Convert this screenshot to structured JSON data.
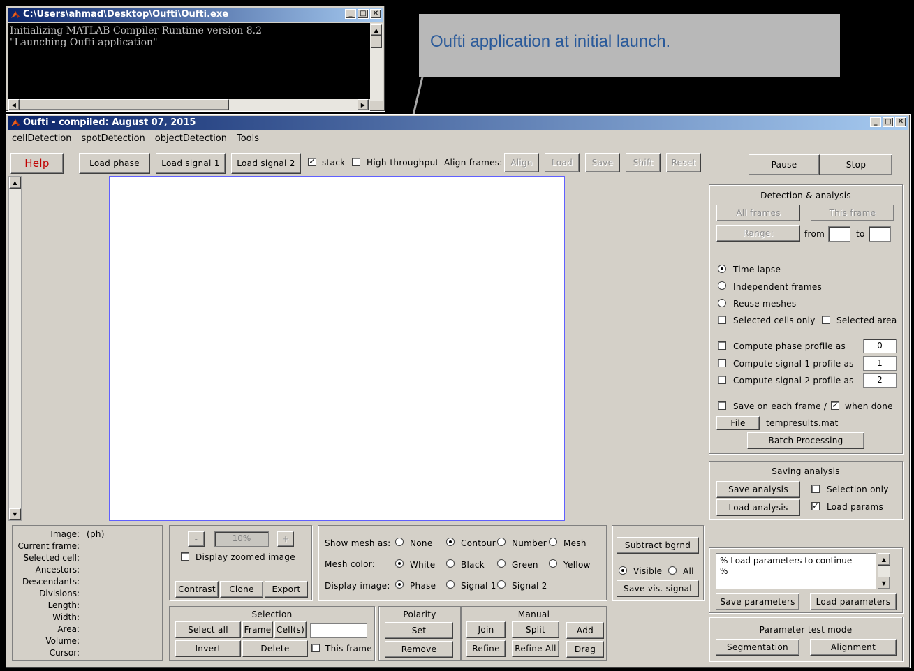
{
  "console": {
    "title": "C:\\Users\\ahmad\\Desktop\\Oufti\\Oufti.exe",
    "line1": "Initializing MATLAB Compiler Runtime version 8.2",
    "line2": "\"Launching Oufti application\""
  },
  "callout": {
    "text": "Oufti application at initial launch."
  },
  "app": {
    "title": "Oufti - compiled: August 07, 2015",
    "menu": [
      "cellDetection",
      "spotDetection",
      "objectDetection",
      "Tools"
    ],
    "toolbar": {
      "help": "Help",
      "load_phase": "Load phase",
      "load_signal1": "Load signal 1",
      "load_signal2": "Load signal 2",
      "stack": "stack",
      "high_throughput": "High-throughput",
      "align_frames": "Align frames:",
      "align": "Align",
      "load": "Load",
      "save": "Save",
      "shift": "Shift",
      "reset": "Reset",
      "pause": "Pause",
      "stop": "Stop"
    },
    "detection": {
      "title": "Detection & analysis",
      "all_frames": "All frames",
      "this_frame": "This frame",
      "range": "Range:",
      "from": "from",
      "to": "to",
      "time_lapse": "Time lapse",
      "independent_frames": "Independent frames",
      "reuse_meshes": "Reuse meshes",
      "selected_cells_only": "Selected cells only",
      "selected_area": "Selected area",
      "compute_phase": "Compute phase profile as",
      "compute_signal1": "Compute signal 1 profile as",
      "compute_signal2": "Compute signal 2 profile as",
      "phase_val": "0",
      "signal1_val": "1",
      "signal2_val": "2",
      "save_each_frame": "Save on each frame /",
      "when_done": "when done",
      "file": "File",
      "filename": "tempresults.mat",
      "batch": "Batch Processing"
    },
    "saving": {
      "title": "Saving analysis",
      "save_analysis": "Save analysis",
      "load_analysis": "Load analysis",
      "selection_only": "Selection only",
      "load_params": "Load params"
    },
    "params": {
      "text1": "% Load parameters to continue",
      "text2": "%",
      "save_parameters": "Save parameters",
      "load_parameters": "Load parameters"
    },
    "test_mode": {
      "title": "Parameter test mode",
      "segmentation": "Segmentation",
      "alignment": "Alignment"
    },
    "info": {
      "image_label": "Image:",
      "image_value": "(ph)",
      "current_frame": "Current frame:",
      "selected_cell": "Selected cell:",
      "ancestors": "Ancestors:",
      "descendants": "Descendants:",
      "divisions": "Divisions:",
      "length": "Length:",
      "width": "Width:",
      "area": "Area:",
      "volume": "Volume:",
      "cursor": "Cursor:"
    },
    "zoom": {
      "minus": "-",
      "value": "10%",
      "plus": "+",
      "display_zoomed": "Display zoomed image",
      "contrast": "Contrast",
      "clone": "Clone",
      "export": "Export"
    },
    "mesh": {
      "show_mesh_as": "Show mesh as:",
      "none": "None",
      "contour": "Contour",
      "number": "Number",
      "mesh": "Mesh",
      "mesh_color": "Mesh color:",
      "white": "White",
      "black": "Black",
      "green": "Green",
      "yellow": "Yellow",
      "display_image": "Display image:",
      "phase": "Phase",
      "signal1": "Signal 1",
      "signal2": "Signal 2"
    },
    "background": {
      "subtract": "Subtract bgrnd",
      "visible": "Visible",
      "all": "All",
      "save_vis_signal": "Save vis. signal"
    },
    "selection": {
      "title": "Selection",
      "select_all": "Select all",
      "frame": "Frame",
      "cells": "Cell(s)",
      "invert": "Invert",
      "delete": "Delete",
      "this_frame": "This frame"
    },
    "polarity": {
      "title": "Polarity",
      "set": "Set",
      "remove": "Remove"
    },
    "manual": {
      "title": "Manual",
      "join": "Join",
      "split": "Split",
      "add": "Add",
      "refine": "Refine",
      "refine_all": "Refine All",
      "drag": "Drag"
    }
  }
}
